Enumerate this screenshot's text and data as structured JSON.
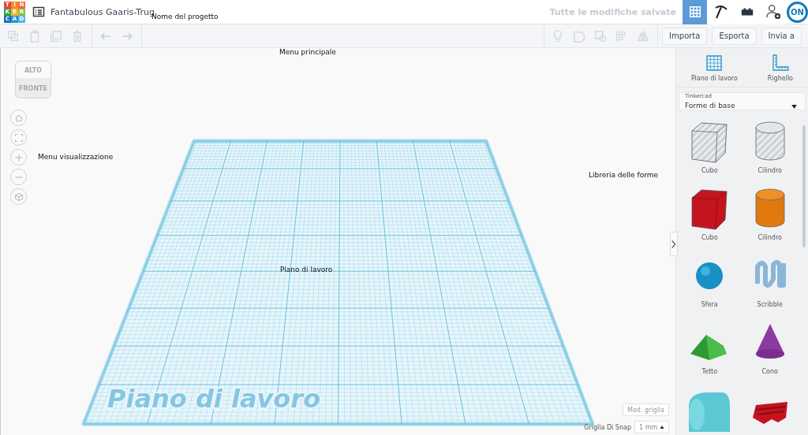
{
  "logo": [
    "T",
    "I",
    "N",
    "K",
    "E",
    "R",
    "C",
    "A",
    "D"
  ],
  "project_title": "Fantabulous Gaaris-Trug",
  "save_status": "Tutte le modifiche salvate",
  "nav": [
    {
      "kind": "grid",
      "selected": true
    },
    {
      "kind": "pickaxe",
      "selected": false
    },
    {
      "kind": "brick",
      "selected": false
    },
    {
      "kind": "user-add",
      "selected": false
    },
    {
      "kind": "avatar",
      "selected": false,
      "text": "ON"
    }
  ],
  "toolbar": {
    "edit_tools": [
      {
        "kind": "copy"
      },
      {
        "kind": "paste"
      },
      {
        "kind": "duplicate"
      },
      {
        "kind": "delete"
      }
    ],
    "history_tools": [
      {
        "kind": "undo"
      },
      {
        "kind": "redo"
      }
    ],
    "view_tools": [
      {
        "kind": "bulb"
      },
      {
        "kind": "note"
      },
      {
        "kind": "shape"
      },
      {
        "kind": "align"
      },
      {
        "kind": "mirror"
      }
    ],
    "buttons": [
      "Importa",
      "Esporta",
      "Invia a"
    ]
  },
  "view_controls": [
    {
      "kind": "home"
    },
    {
      "kind": "fit"
    },
    {
      "kind": "zoom-in"
    },
    {
      "kind": "zoom-out"
    },
    {
      "kind": "perspective"
    }
  ],
  "view_cube": {
    "top": "ALTO",
    "front": "FRONTE"
  },
  "workplane": {
    "label": "Piano di lavoro"
  },
  "grid_edit_button": "Mod. griglia",
  "snap": {
    "label": "Griglia Di Snap",
    "value": "1 mm"
  },
  "panel": {
    "tools": [
      {
        "kind": "workplane",
        "label": "Piano di lavoro"
      },
      {
        "kind": "ruler",
        "label": "Righello"
      }
    ],
    "library": {
      "caption": "Tinkercad",
      "value": "Forme di base"
    },
    "shapes": [
      {
        "kind": "box-hole",
        "label": "Cubo"
      },
      {
        "kind": "cylinder-hole",
        "label": "Cilindro"
      },
      {
        "kind": "box",
        "label": "Cubo"
      },
      {
        "kind": "cylinder",
        "label": "Cilindro"
      },
      {
        "kind": "sphere",
        "label": "Sfera"
      },
      {
        "kind": "scribble",
        "label": "Scribble"
      },
      {
        "kind": "roof",
        "label": "Tetto"
      },
      {
        "kind": "cone",
        "label": "Cono"
      },
      {
        "kind": "half-cylinder"
      },
      {
        "kind": "text-shape"
      }
    ]
  },
  "annotations": [
    "Nome del progetto",
    "Menu principale",
    "Menu visualizzazione",
    "Libreria delle forme",
    "Piano di lavoro"
  ]
}
